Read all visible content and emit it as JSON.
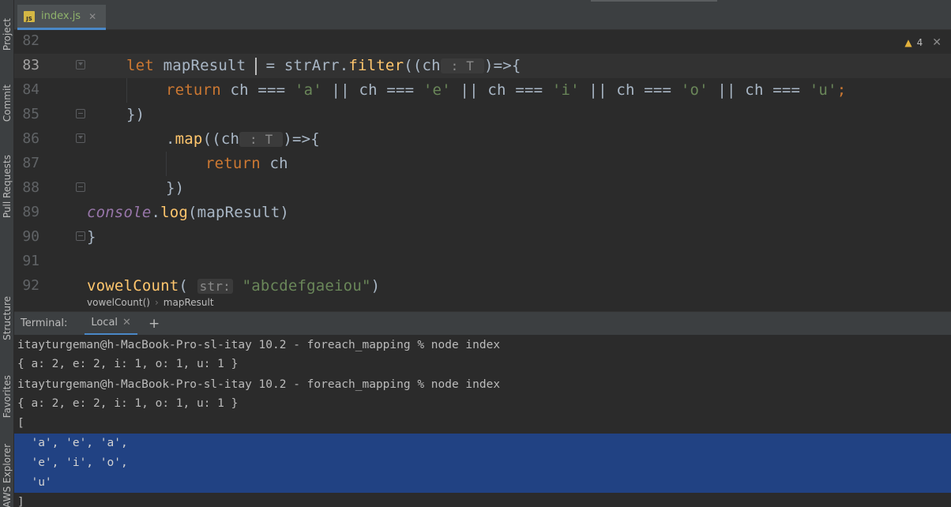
{
  "left_strip": {
    "project": "Project",
    "commit": "Commit",
    "pull_requests": "Pull Requests",
    "structure": "Structure",
    "favorites": "Favorites",
    "aws": "AWS Explorer"
  },
  "tab": {
    "label": "index.js",
    "icon": "JS"
  },
  "inspection": {
    "warnings": "4"
  },
  "editor": {
    "lines": [
      "82",
      "83",
      "84",
      "85",
      "86",
      "87",
      "88",
      "89",
      "90",
      "91",
      "92"
    ],
    "hint_ch": "T",
    "hint_str": "str:",
    "tok": {
      "let": "let",
      "mapResult": "mapResult",
      "eq": "= strArr.",
      "filter": "filter",
      "paren_ch": "((ch",
      "arrow": ")=>{",
      "return": "return",
      "ret_body1": " ch === ",
      "a": "'a'",
      "or1": " || ch === ",
      "e": "'e'",
      "or2": " || ch === ",
      "i": "'i'",
      "or3": " || ch === ",
      "o": "'o'",
      "or4": " || ch === ",
      "u": "'u'",
      "semi": ";",
      "close_paren": "})",
      "dot": ".",
      "map": "map",
      "ret_ch": " ch",
      "console": "console",
      "log": "log",
      "log_arg": "(mapResult)",
      "brace_close": "}",
      "vowelCount": "vowelCount",
      "open": "(",
      "arg": "\"abcdefgaeiou\"",
      "close": ")"
    }
  },
  "breadcrumb": {
    "fn": "vowelCount()",
    "sep": "›",
    "var": "mapResult"
  },
  "terminal": {
    "title": "Terminal:",
    "tab": "Local",
    "lines": [
      "itayturgeman@h-MacBook-Pro-sl-itay 10.2 - foreach_mapping % node index",
      "{ a: 2, e: 2, i: 1, o: 1, u: 1 }",
      "itayturgeman@h-MacBook-Pro-sl-itay 10.2 - foreach_mapping % node index",
      "{ a: 2, e: 2, i: 1, o: 1, u: 1 }",
      "[",
      "  'a', 'e', 'a',",
      "  'e', 'i', 'o',",
      "  'u'",
      "]"
    ]
  }
}
